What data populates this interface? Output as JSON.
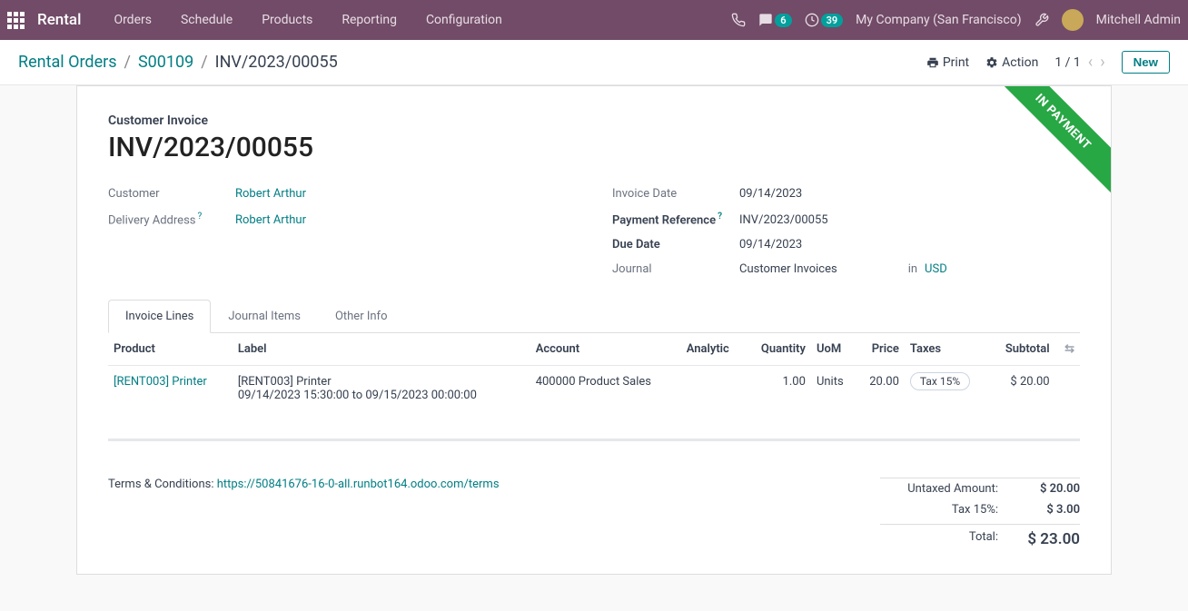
{
  "navbar": {
    "app_name": "Rental",
    "menu": [
      "Orders",
      "Schedule",
      "Products",
      "Reporting",
      "Configuration"
    ],
    "messages_badge": "6",
    "activities_badge": "39",
    "company": "My Company (San Francisco)",
    "user": "Mitchell Admin"
  },
  "controlbar": {
    "breadcrumb": [
      "Rental Orders",
      "S00109",
      "INV/2023/00055"
    ],
    "print": "Print",
    "action": "Action",
    "pager": "1 / 1",
    "new": "New"
  },
  "ribbon": "IN PAYMENT",
  "form": {
    "title_label": "Customer Invoice",
    "title": "INV/2023/00055",
    "left": {
      "customer_label": "Customer",
      "customer": "Robert Arthur",
      "delivery_label": "Delivery Address",
      "delivery": "Robert Arthur"
    },
    "right": {
      "invoice_date_label": "Invoice Date",
      "invoice_date": "09/14/2023",
      "payment_ref_label": "Payment Reference",
      "payment_ref": "INV/2023/00055",
      "due_date_label": "Due Date",
      "due_date": "09/14/2023",
      "journal_label": "Journal",
      "journal": "Customer Invoices",
      "journal_in": "in",
      "currency": "USD"
    }
  },
  "tabs": [
    "Invoice Lines",
    "Journal Items",
    "Other Info"
  ],
  "table": {
    "headers": [
      "Product",
      "Label",
      "Account",
      "Analytic",
      "Quantity",
      "UoM",
      "Price",
      "Taxes",
      "Subtotal"
    ],
    "row": {
      "product": "[RENT003] Printer",
      "label_line1": "[RENT003] Printer",
      "label_line2": "09/14/2023 15:30:00 to 09/15/2023 00:00:00",
      "account": "400000 Product Sales",
      "analytic": "",
      "quantity": "1.00",
      "uom": "Units",
      "price": "20.00",
      "tax": "Tax 15%",
      "subtotal": "$ 20.00"
    }
  },
  "footer": {
    "terms_label": "Terms & Conditions: ",
    "terms_link": "https://50841676-16-0-all.runbot164.odoo.com/terms",
    "untaxed_label": "Untaxed Amount:",
    "untaxed": "$ 20.00",
    "tax_label": "Tax 15%:",
    "tax": "$ 3.00",
    "total_label": "Total:",
    "total": "$ 23.00"
  }
}
